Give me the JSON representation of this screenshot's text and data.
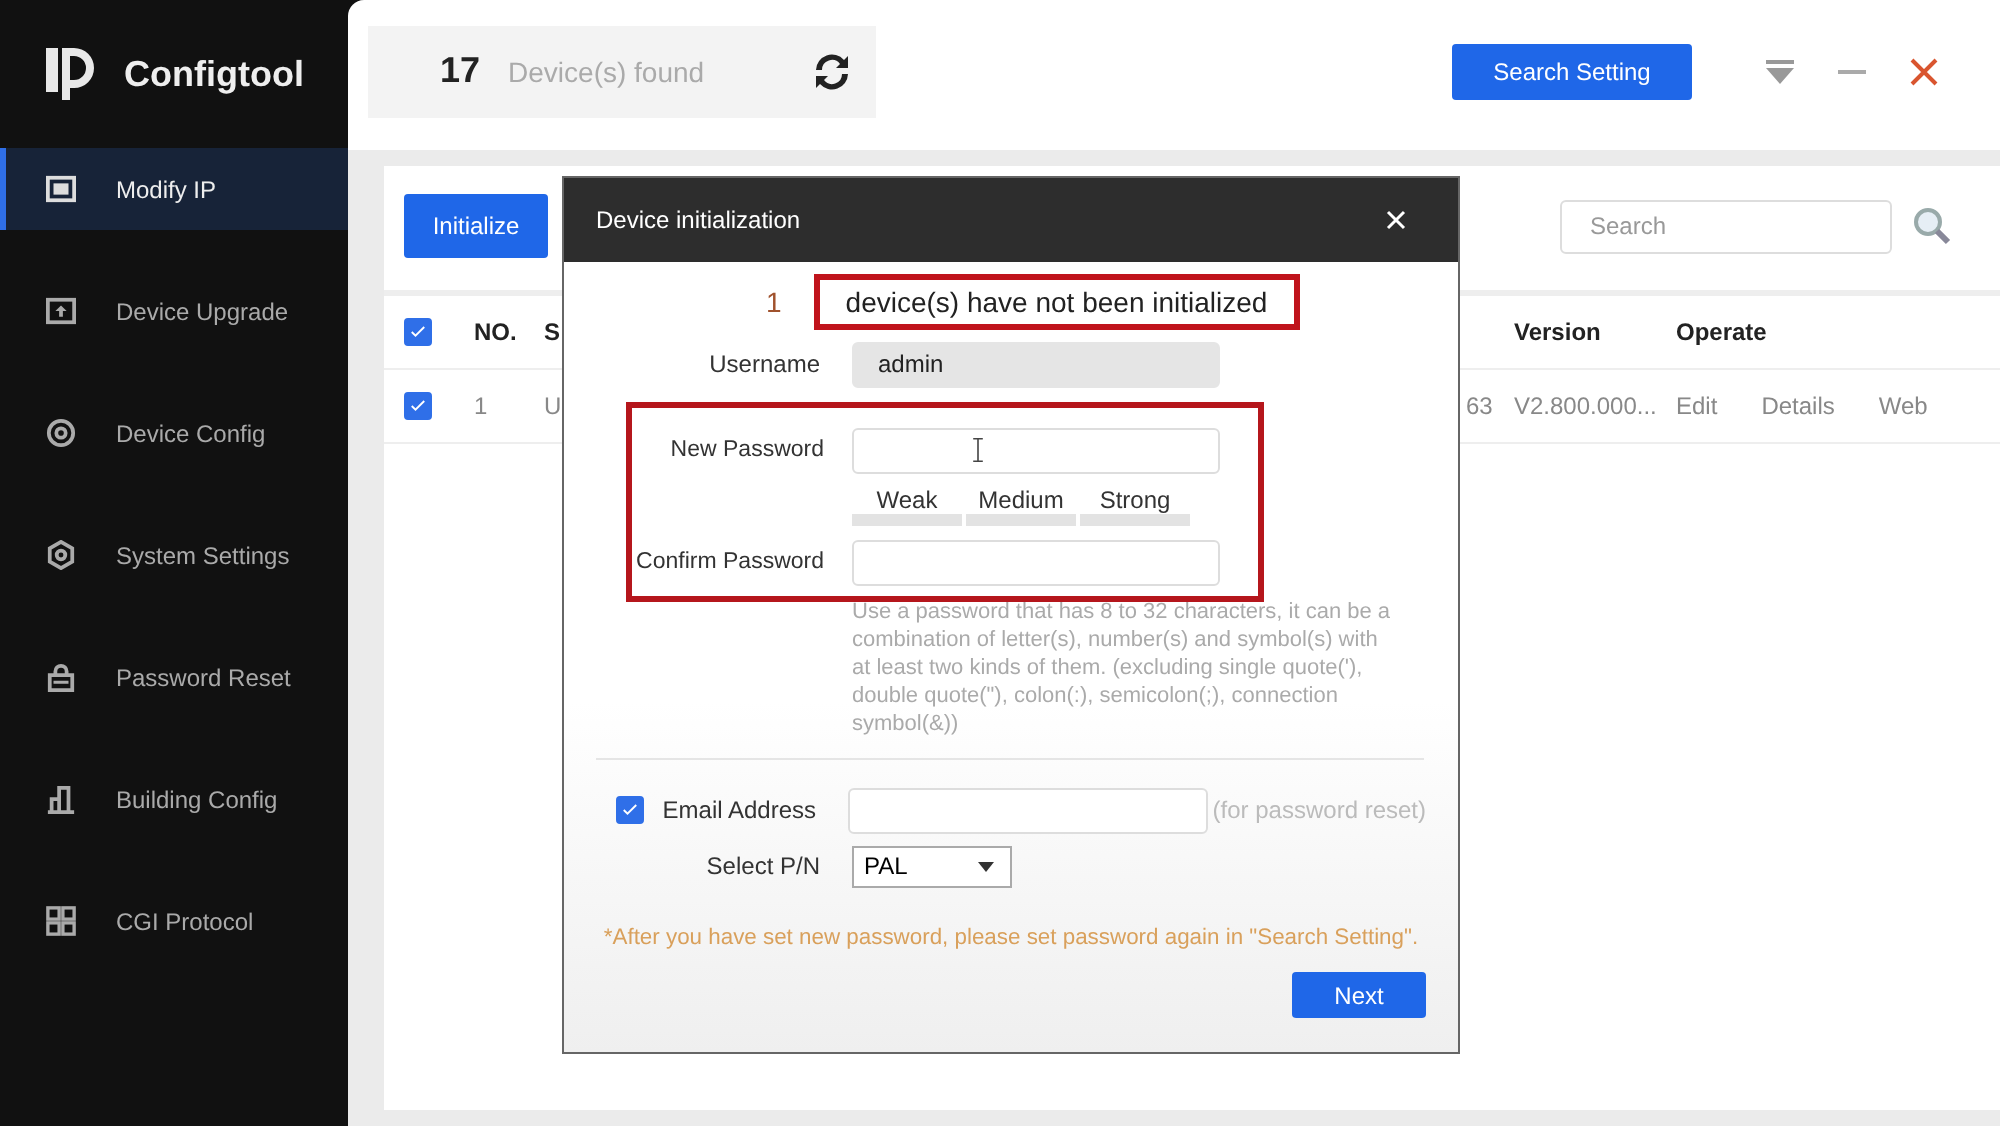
{
  "app": {
    "name": "Configtool"
  },
  "sidebar": {
    "items": [
      {
        "label": "Modify IP",
        "kind": "ip",
        "selected": true
      },
      {
        "label": "Device Upgrade",
        "kind": "upgrade",
        "selected": false
      },
      {
        "label": "Device Config",
        "kind": "config",
        "selected": false
      },
      {
        "label": "System Settings",
        "kind": "settings",
        "selected": false
      },
      {
        "label": "Password Reset",
        "kind": "lock",
        "selected": false
      },
      {
        "label": "Building Config",
        "kind": "building",
        "selected": false
      },
      {
        "label": "CGI Protocol",
        "kind": "cgi",
        "selected": false
      }
    ]
  },
  "header": {
    "device_count": "17",
    "device_label": "Device(s) found",
    "search_setting_button": "Search Setting"
  },
  "toolbar": {
    "initialize_button": "Initialize",
    "search": {
      "placeholder": "Search"
    }
  },
  "table": {
    "select_all_checked": true,
    "columns": [
      "NO.",
      "S",
      "",
      "Version",
      "Operate"
    ],
    "rows": [
      {
        "checked": true,
        "cells": [
          "1",
          "U",
          "63",
          "V2.800.000..."
        ],
        "operations": [
          "Edit",
          "Details",
          "Web"
        ]
      }
    ]
  },
  "dialog": {
    "title": "Device initialization",
    "count": "1",
    "notice": "device(s) have not been initialized",
    "fields": [
      {
        "label": "Username",
        "value": "admin",
        "disabled": true
      },
      {
        "label": "New Password",
        "disabled": false
      },
      {
        "label": "Confirm Password",
        "disabled": false
      }
    ],
    "strength": [
      "Weak",
      "Medium",
      "Strong"
    ],
    "hint": "Use a password that has 8 to 32 characters, it can be a combination of letter(s), number(s) and symbol(s) with at least two kinds of them. (excluding single quote('), double quote(\"), colon(:), semicolon(;), connection symbol(&))",
    "email": {
      "checked": true,
      "label": "Email Address",
      "note": "(for password reset)"
    },
    "pn": {
      "label": "Select P/N",
      "value": "PAL"
    },
    "warning": "*After you have set new password, please set password again in \"Search Setting\".",
    "next_button": "Next"
  }
}
